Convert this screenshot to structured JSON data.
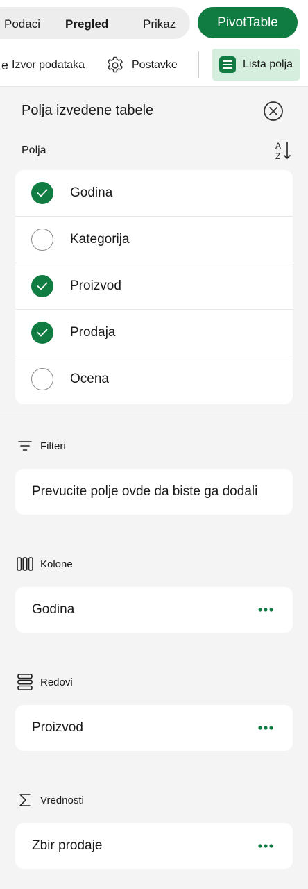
{
  "tabs": {
    "podaci": "Podaci",
    "pregled": "Pregled",
    "prikaz": "Prikaz",
    "pivot": "PivotTable"
  },
  "ribbon": {
    "izvor_prefix": "e",
    "izvor": "Izvor podataka",
    "postavke": "Postavke",
    "lista": "Lista polja"
  },
  "panel": {
    "title": "Polja izvedene tabele",
    "fields_label": "Polja",
    "fields": [
      {
        "label": "Godina",
        "checked": true
      },
      {
        "label": "Kategorija",
        "checked": false
      },
      {
        "label": "Proizvod",
        "checked": true
      },
      {
        "label": "Prodaja",
        "checked": true
      },
      {
        "label": "Ocena",
        "checked": false
      }
    ]
  },
  "areas": {
    "filteri": {
      "label": "Filteri",
      "placeholder": "Prevucite polje ovde da biste ga dodali"
    },
    "kolone": {
      "label": "Kolone",
      "value": "Godina"
    },
    "redovi": {
      "label": "Redovi",
      "value": "Proizvod"
    },
    "vrednosti": {
      "label": "Vrednosti",
      "value": "Zbir prodaje"
    }
  },
  "colors": {
    "accent": "#107c41",
    "accent_light": "#d6eede",
    "panel_bg": "#f4f4f4"
  }
}
